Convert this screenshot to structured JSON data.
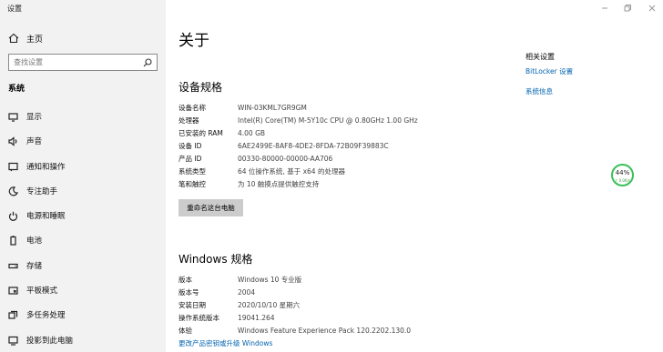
{
  "app": {
    "title": "设置"
  },
  "sidebar": {
    "home_label": "主页",
    "search_placeholder": "查找设置",
    "section_title": "系统",
    "items": [
      {
        "label": "显示",
        "icon": "monitor-icon"
      },
      {
        "label": "声音",
        "icon": "speaker-icon"
      },
      {
        "label": "通知和操作",
        "icon": "notification-icon"
      },
      {
        "label": "专注助手",
        "icon": "moon-icon"
      },
      {
        "label": "电源和睡眠",
        "icon": "power-icon"
      },
      {
        "label": "电池",
        "icon": "battery-icon"
      },
      {
        "label": "存储",
        "icon": "storage-icon"
      },
      {
        "label": "平板模式",
        "icon": "tablet-icon"
      },
      {
        "label": "多任务处理",
        "icon": "multitask-icon"
      },
      {
        "label": "投影到此电脑",
        "icon": "project-icon"
      }
    ]
  },
  "main": {
    "page_title": "关于",
    "device_specs": {
      "heading": "设备规格",
      "rows": [
        {
          "k": "设备名称",
          "v": "WIN-03KML7GR9GM"
        },
        {
          "k": "处理器",
          "v": "Intel(R) Core(TM) M-5Y10c CPU @ 0.80GHz   1.00 GHz"
        },
        {
          "k": "已安装的 RAM",
          "v": "4.00 GB"
        },
        {
          "k": "设备 ID",
          "v": "6AE2499E-8AF8-4DE2-8FDA-72B09F39883C"
        },
        {
          "k": "产品 ID",
          "v": "00330-80000-00000-AA706"
        },
        {
          "k": "系统类型",
          "v": "64 位操作系统, 基于 x64 的处理器"
        },
        {
          "k": "笔和触控",
          "v": "为 10 触摸点提供触控支持"
        }
      ],
      "rename_button": "重命名这台电脑"
    },
    "windows_specs": {
      "heading": "Windows 规格",
      "rows": [
        {
          "k": "版本",
          "v": "Windows 10 专业版"
        },
        {
          "k": "版本号",
          "v": "2004"
        },
        {
          "k": "安装日期",
          "v": "2020/10/10 星期六"
        },
        {
          "k": "操作系统版本",
          "v": "19041.264"
        },
        {
          "k": "体验",
          "v": "Windows Feature Experience Pack 120.2202.130.0"
        }
      ],
      "link": "更改产品密钥或升级 Windows"
    },
    "related": {
      "title": "相关设置",
      "links": [
        "BitLocker 设置",
        "系统信息"
      ]
    }
  },
  "widget": {
    "percent": "44%",
    "speed": "↑ 0.0K/s"
  }
}
